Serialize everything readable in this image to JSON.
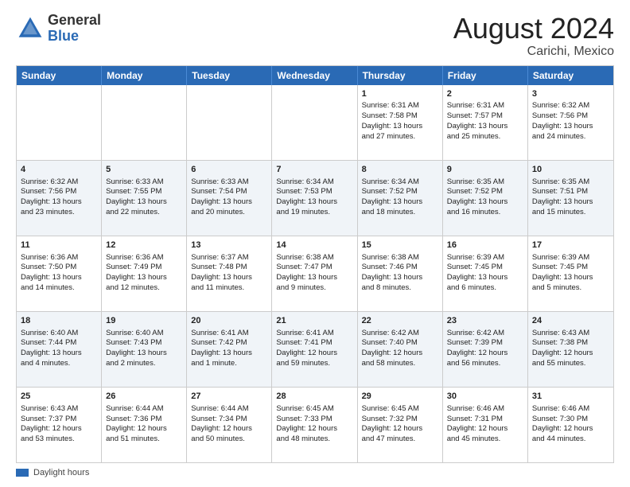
{
  "header": {
    "logo_general": "General",
    "logo_blue": "Blue",
    "month_year": "August 2024",
    "location": "Carichi, Mexico"
  },
  "days_of_week": [
    "Sunday",
    "Monday",
    "Tuesday",
    "Wednesday",
    "Thursday",
    "Friday",
    "Saturday"
  ],
  "legend": {
    "label": "Daylight hours"
  },
  "weeks": [
    {
      "alt": false,
      "cells": [
        {
          "day": "",
          "content": ""
        },
        {
          "day": "",
          "content": ""
        },
        {
          "day": "",
          "content": ""
        },
        {
          "day": "",
          "content": ""
        },
        {
          "day": "1",
          "content": "Sunrise: 6:31 AM\nSunset: 7:58 PM\nDaylight: 13 hours\nand 27 minutes."
        },
        {
          "day": "2",
          "content": "Sunrise: 6:31 AM\nSunset: 7:57 PM\nDaylight: 13 hours\nand 25 minutes."
        },
        {
          "day": "3",
          "content": "Sunrise: 6:32 AM\nSunset: 7:56 PM\nDaylight: 13 hours\nand 24 minutes."
        }
      ]
    },
    {
      "alt": true,
      "cells": [
        {
          "day": "4",
          "content": "Sunrise: 6:32 AM\nSunset: 7:56 PM\nDaylight: 13 hours\nand 23 minutes."
        },
        {
          "day": "5",
          "content": "Sunrise: 6:33 AM\nSunset: 7:55 PM\nDaylight: 13 hours\nand 22 minutes."
        },
        {
          "day": "6",
          "content": "Sunrise: 6:33 AM\nSunset: 7:54 PM\nDaylight: 13 hours\nand 20 minutes."
        },
        {
          "day": "7",
          "content": "Sunrise: 6:34 AM\nSunset: 7:53 PM\nDaylight: 13 hours\nand 19 minutes."
        },
        {
          "day": "8",
          "content": "Sunrise: 6:34 AM\nSunset: 7:52 PM\nDaylight: 13 hours\nand 18 minutes."
        },
        {
          "day": "9",
          "content": "Sunrise: 6:35 AM\nSunset: 7:52 PM\nDaylight: 13 hours\nand 16 minutes."
        },
        {
          "day": "10",
          "content": "Sunrise: 6:35 AM\nSunset: 7:51 PM\nDaylight: 13 hours\nand 15 minutes."
        }
      ]
    },
    {
      "alt": false,
      "cells": [
        {
          "day": "11",
          "content": "Sunrise: 6:36 AM\nSunset: 7:50 PM\nDaylight: 13 hours\nand 14 minutes."
        },
        {
          "day": "12",
          "content": "Sunrise: 6:36 AM\nSunset: 7:49 PM\nDaylight: 13 hours\nand 12 minutes."
        },
        {
          "day": "13",
          "content": "Sunrise: 6:37 AM\nSunset: 7:48 PM\nDaylight: 13 hours\nand 11 minutes."
        },
        {
          "day": "14",
          "content": "Sunrise: 6:38 AM\nSunset: 7:47 PM\nDaylight: 13 hours\nand 9 minutes."
        },
        {
          "day": "15",
          "content": "Sunrise: 6:38 AM\nSunset: 7:46 PM\nDaylight: 13 hours\nand 8 minutes."
        },
        {
          "day": "16",
          "content": "Sunrise: 6:39 AM\nSunset: 7:45 PM\nDaylight: 13 hours\nand 6 minutes."
        },
        {
          "day": "17",
          "content": "Sunrise: 6:39 AM\nSunset: 7:45 PM\nDaylight: 13 hours\nand 5 minutes."
        }
      ]
    },
    {
      "alt": true,
      "cells": [
        {
          "day": "18",
          "content": "Sunrise: 6:40 AM\nSunset: 7:44 PM\nDaylight: 13 hours\nand 4 minutes."
        },
        {
          "day": "19",
          "content": "Sunrise: 6:40 AM\nSunset: 7:43 PM\nDaylight: 13 hours\nand 2 minutes."
        },
        {
          "day": "20",
          "content": "Sunrise: 6:41 AM\nSunset: 7:42 PM\nDaylight: 13 hours\nand 1 minute."
        },
        {
          "day": "21",
          "content": "Sunrise: 6:41 AM\nSunset: 7:41 PM\nDaylight: 12 hours\nand 59 minutes."
        },
        {
          "day": "22",
          "content": "Sunrise: 6:42 AM\nSunset: 7:40 PM\nDaylight: 12 hours\nand 58 minutes."
        },
        {
          "day": "23",
          "content": "Sunrise: 6:42 AM\nSunset: 7:39 PM\nDaylight: 12 hours\nand 56 minutes."
        },
        {
          "day": "24",
          "content": "Sunrise: 6:43 AM\nSunset: 7:38 PM\nDaylight: 12 hours\nand 55 minutes."
        }
      ]
    },
    {
      "alt": false,
      "cells": [
        {
          "day": "25",
          "content": "Sunrise: 6:43 AM\nSunset: 7:37 PM\nDaylight: 12 hours\nand 53 minutes."
        },
        {
          "day": "26",
          "content": "Sunrise: 6:44 AM\nSunset: 7:36 PM\nDaylight: 12 hours\nand 51 minutes."
        },
        {
          "day": "27",
          "content": "Sunrise: 6:44 AM\nSunset: 7:34 PM\nDaylight: 12 hours\nand 50 minutes."
        },
        {
          "day": "28",
          "content": "Sunrise: 6:45 AM\nSunset: 7:33 PM\nDaylight: 12 hours\nand 48 minutes."
        },
        {
          "day": "29",
          "content": "Sunrise: 6:45 AM\nSunset: 7:32 PM\nDaylight: 12 hours\nand 47 minutes."
        },
        {
          "day": "30",
          "content": "Sunrise: 6:46 AM\nSunset: 7:31 PM\nDaylight: 12 hours\nand 45 minutes."
        },
        {
          "day": "31",
          "content": "Sunrise: 6:46 AM\nSunset: 7:30 PM\nDaylight: 12 hours\nand 44 minutes."
        }
      ]
    }
  ]
}
